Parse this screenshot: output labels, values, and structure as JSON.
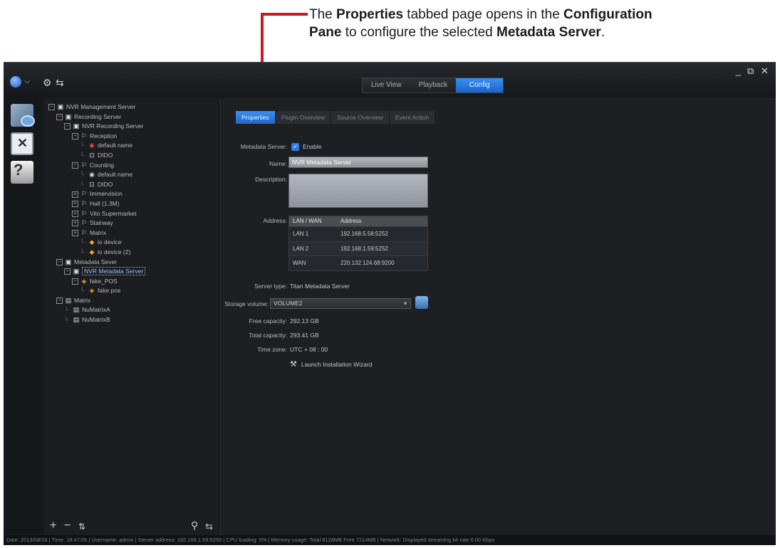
{
  "annotation": {
    "line1_pre": "The ",
    "line1_bold1": "Properties",
    "line1_mid": " tabbed page opens in the ",
    "line1_bold2": "Configuration",
    "line2_bold1": "Pane",
    "line2_mid": " to configure the selected ",
    "line2_bold2": "Metadata Server",
    "line2_end": ".",
    "accent_color": "#d4141c"
  },
  "modes": [
    "Live View",
    "Playback",
    "Config"
  ],
  "active_mode": "Config",
  "window_controls": {
    "minimize": "_",
    "restore": "⧉",
    "close": "✕"
  },
  "tree": [
    {
      "label": "NVR Management Server",
      "icon": "server",
      "exp": "⊟"
    },
    {
      "label": "Recording Server",
      "icon": "server",
      "exp": "⊟"
    },
    {
      "label": "NVR Recording Server",
      "icon": "server",
      "exp": "⊟"
    },
    {
      "label": "Reception",
      "icon": "group",
      "exp": "⊟"
    },
    {
      "label": "default name",
      "icon": "camera-red"
    },
    {
      "label": "DIDO",
      "icon": "dido"
    },
    {
      "label": "Counting",
      "icon": "group",
      "exp": "⊟"
    },
    {
      "label": "default name",
      "icon": "camera"
    },
    {
      "label": "DIDO",
      "icon": "dido"
    },
    {
      "label": "Immervision",
      "icon": "group",
      "exp": "⊞"
    },
    {
      "label": "Hall (1.3M)",
      "icon": "group",
      "exp": "⊞"
    },
    {
      "label": "Vito Supermarket",
      "icon": "group",
      "exp": "⊞"
    },
    {
      "label": "Stairway",
      "icon": "group",
      "exp": "⊞"
    },
    {
      "label": "Matrix",
      "icon": "group",
      "exp": "⊞"
    },
    {
      "label": "io device",
      "icon": "io"
    },
    {
      "label": "io device (2)",
      "icon": "io"
    },
    {
      "label": "Metadata Sever",
      "icon": "server",
      "exp": "⊟"
    },
    {
      "label": "NVR Metadata Server",
      "icon": "server",
      "exp": "⊟",
      "selected": true
    },
    {
      "label": "fake_POS",
      "icon": "pos",
      "exp": "⊟"
    },
    {
      "label": "fake pos",
      "icon": "pos"
    },
    {
      "label": "Matrix",
      "icon": "matrix",
      "exp": "⊟"
    },
    {
      "label": "NuMatrixA",
      "icon": "matrix"
    },
    {
      "label": "NuMatrixB",
      "icon": "matrix"
    }
  ],
  "tabs": [
    "Properties",
    "Plugin Overview",
    "Source Overview",
    "Event Action"
  ],
  "active_tab": "Properties",
  "form": {
    "metadata_server_label": "Metadata Server:",
    "enable_label": "Enable",
    "enable_checked": true,
    "name_label": "Name:",
    "name_value": "NVR Metadata Server",
    "description_label": "Description:",
    "description_value": "",
    "address_label": "Address:",
    "address_headers": [
      "LAN / WAN",
      "Address"
    ],
    "addresses": [
      {
        "type": "LAN 1",
        "addr": "192.168.5.58:5252"
      },
      {
        "type": "LAN 2",
        "addr": "192.168.1.59:5252"
      },
      {
        "type": "WAN",
        "addr": "220.132.124.68:9200"
      }
    ],
    "server_type_label": "Server type:",
    "server_type_value": "Titan Metadata Server",
    "storage_label": "Storage volume:",
    "storage_value": "VOLUME2",
    "free_label": "Free capacity:",
    "free_value": "292.13 GB",
    "total_label": "Total capacity:",
    "total_value": "293.41 GB",
    "tz_label": "Time zone:",
    "tz_value": "UTC + 08 : 00",
    "wizard_label": "Launch Installation Wizard"
  },
  "statusbar": "Date: 2013/08/16 | Time: 18:47:55 | Username: admin | Server address: 192.168.1.59:5250 | CPU loading: 0% | Memory usage: Total 8128MB Free 7214MB | Network: Displayed streaming bit rate    0.00 Kbps"
}
